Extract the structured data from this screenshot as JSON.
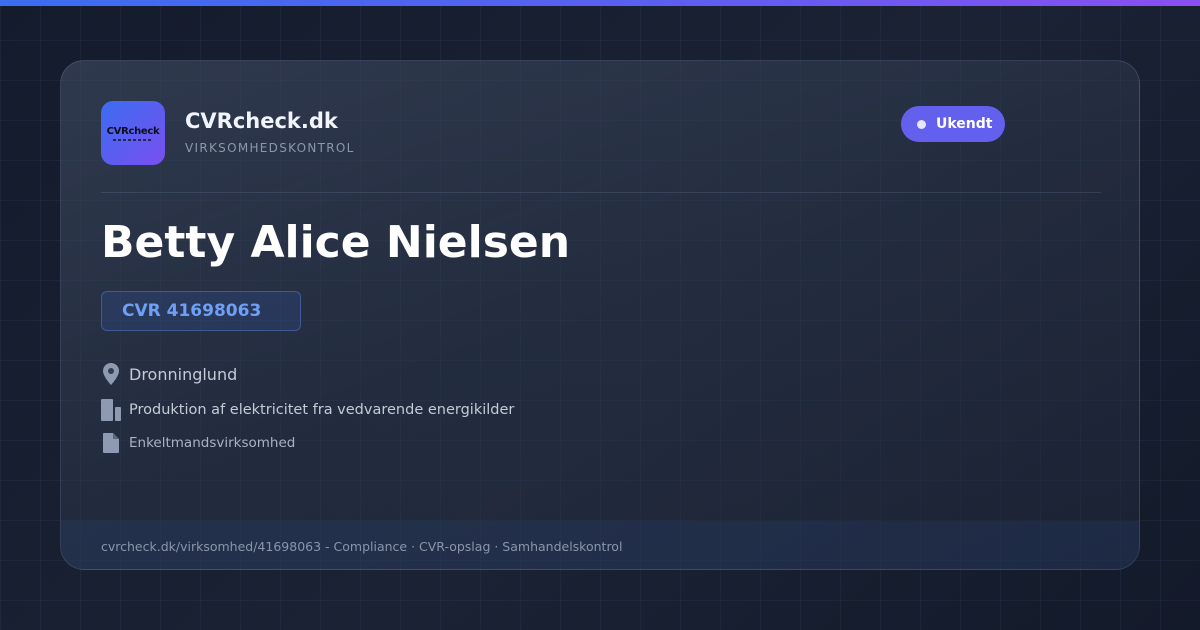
{
  "brand": {
    "logo_text": "CVRcheck",
    "name": "CVRcheck.dk",
    "subtitle": "VIRKSOMHEDSKONTROL"
  },
  "status": {
    "label": "Ukendt",
    "color": "#6360ee"
  },
  "company": {
    "name": "Betty Alice Nielsen",
    "cvr_label": "CVR 41698063",
    "location": "Dronninglund",
    "industry": "Produktion af elektricitet fra vedvarende energikilder",
    "company_type": "Enkeltmandsvirksomhed"
  },
  "icons": {
    "location": "map-pin-icon",
    "industry": "building-icon",
    "company_type": "document-icon"
  },
  "footer": {
    "text": "cvrcheck.dk/virksomhed/41698063 - Compliance · CVR-opslag · Samhandelskontrol"
  },
  "colors": {
    "accent": "#6360ee",
    "cvr_text": "#6fa0f5",
    "gradient_start": "#3b6df0",
    "gradient_end": "#8a4ff0"
  }
}
